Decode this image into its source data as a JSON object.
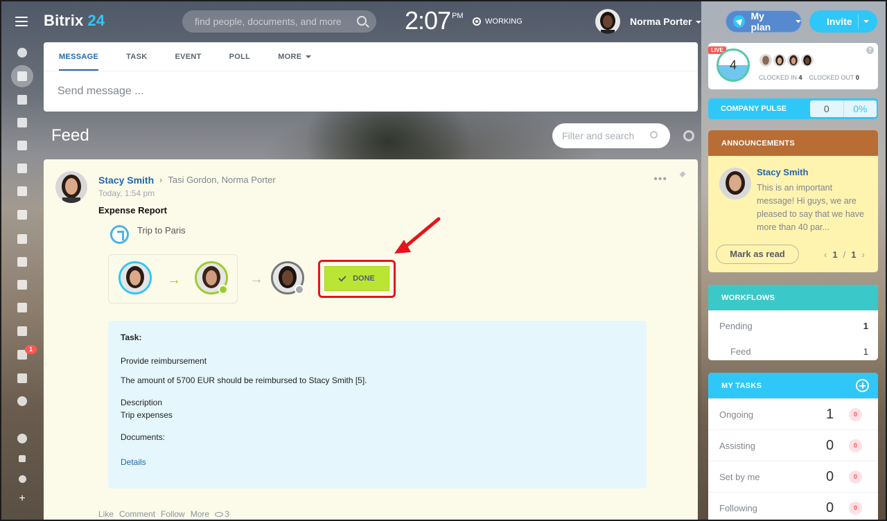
{
  "header": {
    "logo_name": "Bitrix",
    "logo_num": "24",
    "search_placeholder": "find people, documents, and more",
    "clock_time": "2:07",
    "clock_ampm": "PM",
    "work_status": "WORKING",
    "user_name": "Norma Porter",
    "plan_label": "My plan",
    "invite_label": "Invite"
  },
  "rail": {
    "icons": [
      "activity-stream-icon",
      "feed-icon",
      "chat-icon",
      "calendar-icon",
      "documents-icon",
      "drive-icon",
      "mail-icon",
      "groups-icon",
      "tasks-icon",
      "company-icon",
      "sites-icon",
      "sign-icon",
      "contact-center-icon",
      "crm-icon",
      "inventory-icon",
      "more-icon",
      "help-icon",
      "sitemap-icon",
      "settings-icon",
      "add-icon"
    ],
    "notification_count": "1"
  },
  "composer": {
    "tabs": [
      "MESSAGE",
      "TASK",
      "EVENT",
      "POLL",
      "MORE"
    ],
    "placeholder": "Send message ..."
  },
  "feed": {
    "title": "Feed",
    "filter_placeholder": "Filter and search"
  },
  "post": {
    "author": "Stacy Smith",
    "recipients": "Tasi Gordon, Norma Porter",
    "time": "Today, 1:54 pm",
    "title": "Expense Report",
    "trip": "Trip to Paris",
    "done_label": "DONE",
    "task_heading": "Task:",
    "task_name": "Provide reimbursement",
    "task_amount": "The amount of 5700 EUR should be reimbursed to Stacy Smith [5].",
    "desc_label": "Description",
    "desc_value": "Trip expenses",
    "docs_label": "Documents:",
    "details_link": "Details",
    "actions": [
      "Like",
      "Comment",
      "Follow",
      "More"
    ],
    "views": "3"
  },
  "live": {
    "tag": "LIVE",
    "count": "4",
    "clocked_in_label": "CLOCKED IN",
    "clocked_in": "4",
    "clocked_out_label": "CLOCKED OUT",
    "clocked_out": "0",
    "help": "?"
  },
  "pulse": {
    "label": "COMPANY PULSE",
    "value": "0",
    "percent": "0%"
  },
  "announcements": {
    "title": "ANNOUNCEMENTS",
    "author": "Stacy Smith",
    "text": "This is an important message! Hi guys, we are pleased to say that we have more than 40 par...",
    "mark_read": "Mark as read",
    "page": "1",
    "sep": "/",
    "pages": "1"
  },
  "workflows": {
    "title": "WORKFLOWS",
    "rows": [
      {
        "label": "Pending",
        "value": "1"
      },
      {
        "label": "Feed",
        "value": "1"
      }
    ]
  },
  "tasks": {
    "title": "MY TASKS",
    "rows": [
      {
        "label": "Ongoing",
        "count": "1",
        "badge": "0"
      },
      {
        "label": "Assisting",
        "count": "0",
        "badge": "0"
      },
      {
        "label": "Set by me",
        "count": "0",
        "badge": "0"
      },
      {
        "label": "Following",
        "count": "0",
        "badge": "0"
      }
    ]
  },
  "colors": {
    "accent": "#2fc7f7",
    "link": "#2067b0",
    "done_green": "#bbe535",
    "highlight_red": "#e5141b",
    "announcements": "#b76d34",
    "workflows": "#3bc8c8"
  }
}
